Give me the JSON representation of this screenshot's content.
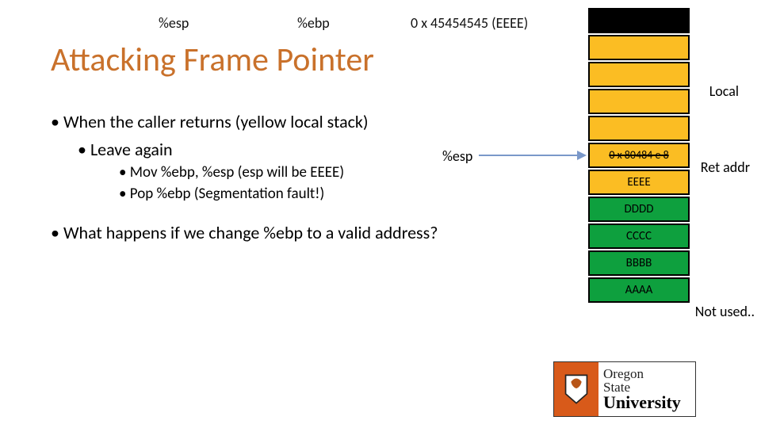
{
  "top": {
    "esp": "%esp",
    "ebp": "%ebp",
    "addr": "0 x 45454545 (EEEE)"
  },
  "title": "Attacking Frame Pointer",
  "bullets": {
    "b1": "When the caller returns (yellow local stack)",
    "b2": "Leave again",
    "b3a": "Mov %ebp, %esp (esp will be EEEE)",
    "b3b": "Pop %ebp (Segmentation fault!)",
    "q": "What happens if we change %ebp to a valid address?"
  },
  "esp_inline": "%esp",
  "stack": {
    "ret_struck": "0 x 80484 e 8",
    "ebp_val": "EEEE",
    "g1": "DDDD",
    "g2": "CCCC",
    "g3": "BBBB",
    "g4": "AAAA"
  },
  "side": {
    "local": "Local",
    "ret": "Ret addr",
    "notused": "Not used.."
  },
  "logo": {
    "line1": "Oregon",
    "line2": "State",
    "line3": "University"
  }
}
